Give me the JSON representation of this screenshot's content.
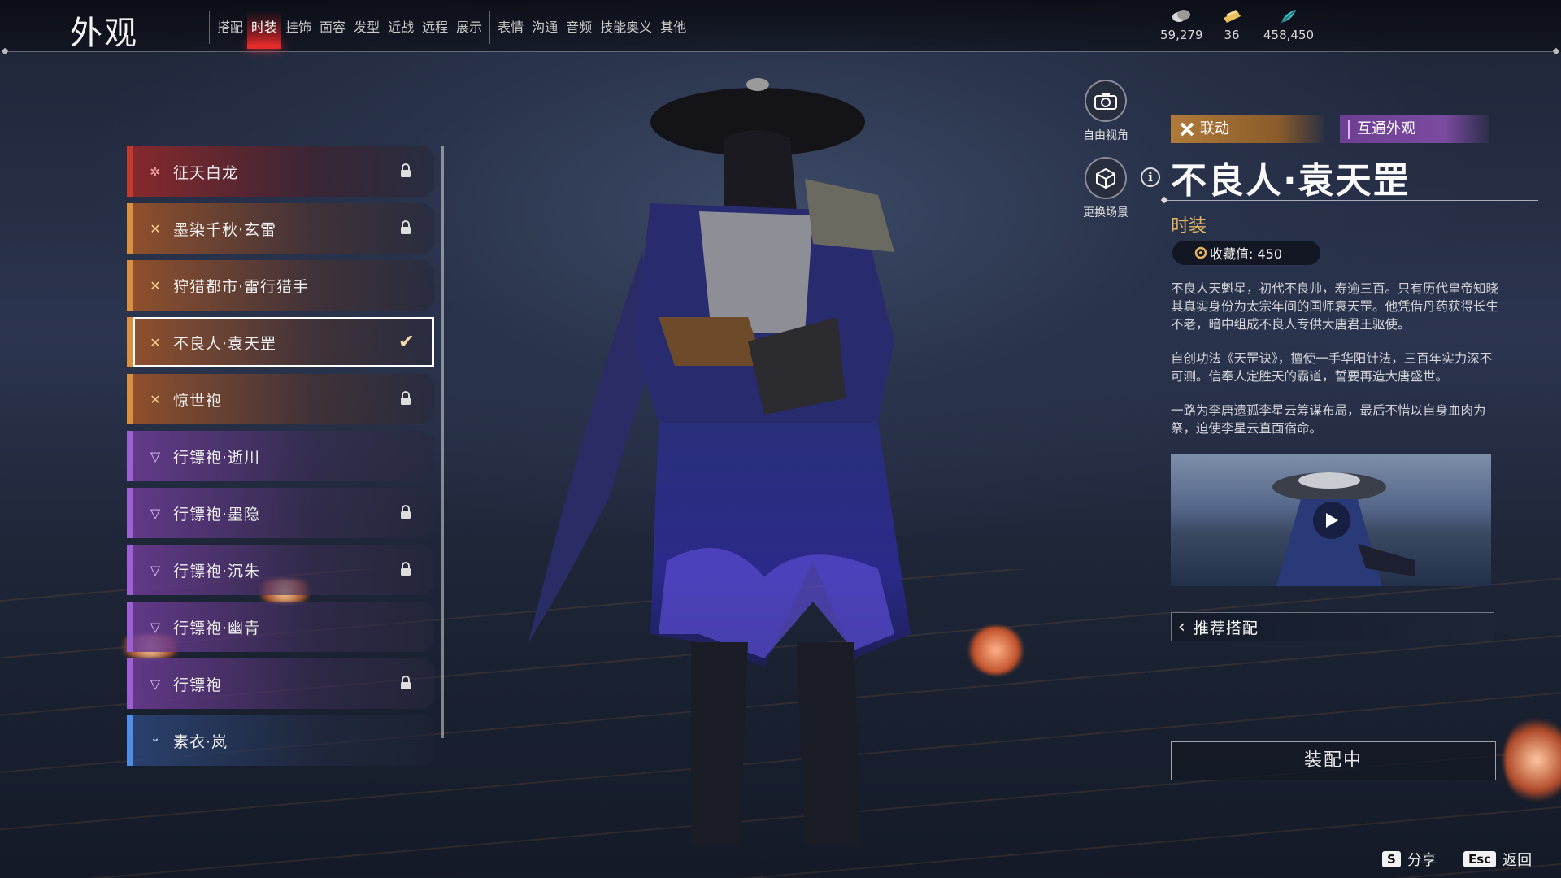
{
  "page": {
    "title": "外观"
  },
  "tabs": [
    {
      "label": "搭配",
      "active": false
    },
    {
      "label": "时装",
      "active": true
    },
    {
      "label": "挂饰",
      "active": false
    },
    {
      "label": "面容",
      "active": false
    },
    {
      "label": "发型",
      "active": false
    },
    {
      "label": "近战",
      "active": false
    },
    {
      "label": "远程",
      "active": false
    },
    {
      "label": "展示",
      "active": false
    },
    {
      "label": "表情",
      "active": false
    },
    {
      "label": "沟通",
      "active": false
    },
    {
      "label": "音频",
      "active": false
    },
    {
      "label": "技能奥义",
      "active": false
    },
    {
      "label": "其他",
      "active": false
    }
  ],
  "currencies": [
    {
      "icon": "coin-stack-icon",
      "value": "59,279"
    },
    {
      "icon": "ticket-icon",
      "value": "36"
    },
    {
      "icon": "feather-icon",
      "value": "458,450"
    }
  ],
  "outfits": [
    {
      "label": "征天白龙",
      "rarity": "red",
      "locked": true,
      "selected": false
    },
    {
      "label": "墨染千秋·玄雷",
      "rarity": "gold",
      "locked": true,
      "selected": false
    },
    {
      "label": "狩猎都市·雷行猎手",
      "rarity": "gold",
      "locked": false,
      "selected": false
    },
    {
      "label": "不良人·袁天罡",
      "rarity": "gold",
      "locked": false,
      "selected": true
    },
    {
      "label": "惊世袍",
      "rarity": "gold",
      "locked": true,
      "selected": false
    },
    {
      "label": "行镖袍·逝川",
      "rarity": "purple",
      "locked": false,
      "selected": false
    },
    {
      "label": "行镖袍·墨隐",
      "rarity": "purple",
      "locked": true,
      "selected": false
    },
    {
      "label": "行镖袍·沉朱",
      "rarity": "purple",
      "locked": true,
      "selected": false
    },
    {
      "label": "行镖袍·幽青",
      "rarity": "purple",
      "locked": false,
      "selected": false
    },
    {
      "label": "行镖袍",
      "rarity": "purple",
      "locked": true,
      "selected": false
    },
    {
      "label": "素衣·岚",
      "rarity": "blue",
      "locked": false,
      "selected": false
    }
  ],
  "tools": {
    "free_view": "自由视角",
    "change_scene": "更换场景"
  },
  "detail": {
    "tag_collab": "联动",
    "tag_shared": "互通外观",
    "name": "不良人·袁天罡",
    "type": "时装",
    "collect_value": "收藏值: 450",
    "desc": [
      "不良人天魁星，初代不良帅，寿逾三百。只有历代皇帝知晓其真实身份为太宗年间的国师袁天罡。他凭借丹药获得长生不老，暗中组成不良人专供大唐君王驱使。",
      "自创功法《天罡诀》，擅使一手华阳针法，三百年实力深不可测。信奉人定胜天的霸道，誓要再造大唐盛世。",
      "一路为李唐遗孤李星云筹谋布局，最后不惜以自身血肉为祭，迫使李星云直面宿命。"
    ],
    "recommend": "推荐搭配",
    "equip": "装配中"
  },
  "hints": {
    "share_key": "S",
    "share_label": "分享",
    "back_key": "Esc",
    "back_label": "返回"
  },
  "colors": {
    "active_tab": "#e32b2b",
    "rarity_red": "#c33a2c",
    "rarity_gold": "#d98f3c",
    "rarity_purple": "#9c5fd6",
    "rarity_blue": "#4d8ee8",
    "type_text": "#e5b564"
  }
}
